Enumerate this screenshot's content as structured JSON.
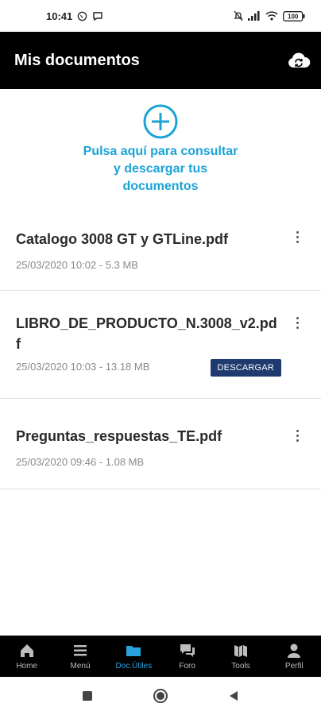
{
  "status_bar": {
    "time": "10:41",
    "battery": "100"
  },
  "header": {
    "title": "Mis documentos",
    "sync_icon": "cloud-sync-icon"
  },
  "add_area": {
    "text": "Pulsa aquí para consultar y descargar tus documentos",
    "accent": "#1ba3d6"
  },
  "documents": [
    {
      "title": "Catalogo 3008 GT y GTLine.pdf",
      "meta": "25/03/2020 10:02 - 5.3 MB",
      "download_label": ""
    },
    {
      "title": "LIBRO_DE_PRODUCTO_N.3008_v2.pdf",
      "meta": "25/03/2020 10:03 - 13.18 MB",
      "download_label": "DESCARGAR"
    },
    {
      "title": "Preguntas_respuestas_TE.pdf",
      "meta": "25/03/2020 09:46 - 1.08 MB",
      "download_label": ""
    }
  ],
  "bottom_nav": {
    "items": [
      {
        "label": "Home",
        "icon": "home-icon"
      },
      {
        "label": "Menú",
        "icon": "menu-icon"
      },
      {
        "label": "Doc.Útiles",
        "icon": "folder-icon"
      },
      {
        "label": "Foro",
        "icon": "forum-icon"
      },
      {
        "label": "Tools",
        "icon": "tools-icon"
      },
      {
        "label": "Perfil",
        "icon": "profile-icon"
      }
    ],
    "active_index": 2,
    "active_color": "#2aa3de"
  }
}
